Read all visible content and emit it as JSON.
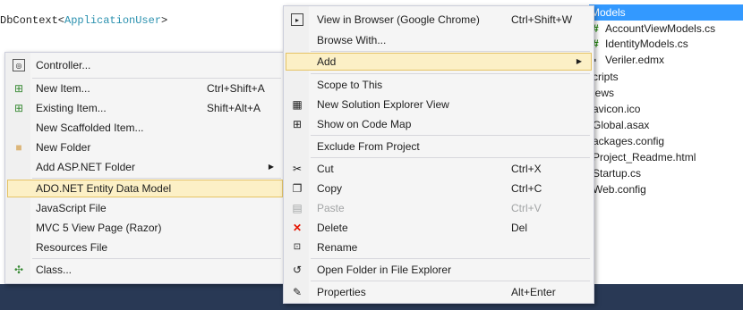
{
  "editor": {
    "code_part1": "DbContext<",
    "code_part2": "ApplicationUser",
    "code_part3": ">"
  },
  "solution_explorer": {
    "items": [
      {
        "label": "Models",
        "selected": true
      },
      {
        "label": "AccountViewModels.cs",
        "icon": "csharp-file-icon"
      },
      {
        "label": "IdentityModels.cs",
        "icon": "csharp-file-icon"
      },
      {
        "label": "Veriler.edmx",
        "icon": "edmx-file-icon"
      },
      {
        "label": "cripts"
      },
      {
        "label": "iews"
      },
      {
        "label": "avicon.ico"
      },
      {
        "label": "Global.asax"
      },
      {
        "label": "ackages.config"
      },
      {
        "label": "Project_Readme.html"
      },
      {
        "label": "Startup.cs"
      },
      {
        "label": "Web.config"
      }
    ]
  },
  "add_submenu": {
    "items": [
      {
        "label": "Controller...",
        "icon": "controller-icon"
      },
      {
        "label": "New Item...",
        "shortcut": "Ctrl+Shift+A",
        "icon": "new-item-icon"
      },
      {
        "label": "Existing Item...",
        "shortcut": "Shift+Alt+A",
        "icon": "existing-item-icon"
      },
      {
        "label": "New Scaffolded Item..."
      },
      {
        "label": "New Folder",
        "icon": "folder-icon"
      },
      {
        "label": "Add ASP.NET Folder",
        "has_submenu": true
      },
      {
        "label": "ADO.NET Entity Data Model",
        "highlighted": true
      },
      {
        "label": "JavaScript File"
      },
      {
        "label": "MVC 5 View Page (Razor)"
      },
      {
        "label": "Resources File"
      },
      {
        "label": "Class...",
        "icon": "class-icon"
      }
    ]
  },
  "context_menu": {
    "items": [
      {
        "label": "View in Browser (Google Chrome)",
        "shortcut": "Ctrl+Shift+W",
        "icon": "browser-icon"
      },
      {
        "label": "Browse With..."
      },
      {
        "label": "Add",
        "has_submenu": true,
        "highlighted": true
      },
      {
        "label": "Scope to This"
      },
      {
        "label": "New Solution Explorer View",
        "icon": "solution-explorer-view-icon"
      },
      {
        "label": "Show on Code Map",
        "icon": "code-map-icon"
      },
      {
        "label": "Exclude From Project"
      },
      {
        "label": "Cut",
        "shortcut": "Ctrl+X",
        "icon": "cut-icon"
      },
      {
        "label": "Copy",
        "shortcut": "Ctrl+C",
        "icon": "copy-icon"
      },
      {
        "label": "Paste",
        "shortcut": "Ctrl+V",
        "icon": "paste-icon",
        "disabled": true
      },
      {
        "label": "Delete",
        "shortcut": "Del",
        "icon": "delete-icon"
      },
      {
        "label": "Rename",
        "icon": "rename-icon"
      },
      {
        "label": "Open Folder in File Explorer",
        "icon": "open-folder-icon"
      },
      {
        "label": "Properties",
        "shortcut": "Alt+Enter",
        "icon": "properties-icon"
      }
    ]
  },
  "colors": {
    "selection": "#3399ff",
    "highlight_bg": "#fcf0c6",
    "highlight_border": "#e5c365",
    "status_band": "#293955",
    "delete_icon": "#e51400"
  }
}
